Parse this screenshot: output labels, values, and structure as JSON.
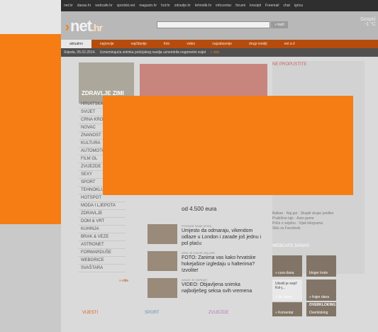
{
  "topnav": {
    "items": [
      "net.hr",
      "danas.hr",
      "webcafe.hr",
      "sportski.net",
      "magazin.hr",
      "hot.hr",
      "zdravlje.hr",
      "tehnotik.hr",
      "infocentar",
      "forumi",
      "kresipit",
      "Freemail",
      "chat",
      "igrica"
    ]
  },
  "header": {
    "logo_main": "net",
    "logo_tld": ".hr",
    "search_button": "» traži",
    "weather_city": "Gospić",
    "weather_temp": "-1 °C"
  },
  "mainnav": {
    "items": [
      "aktualno",
      "najnovije",
      "najčitanije",
      "foto",
      "video",
      "najzabavnije",
      "drugi mediji",
      "net a-ž"
    ]
  },
  "datebar": {
    "date": "Srijeda, 05.02.2014.",
    "ticker": "Uznemirujuća snimka policijskog nasilja uznemirila nogometni svijet",
    "more": "» više"
  },
  "left": {
    "promo_title": "ZDRAVLJE ZIMI",
    "categories": [
      "HRVATSKA",
      "SVIJET",
      "CRNA KRONIKA",
      "NOVAC",
      "ZNANOST",
      "KULTURA",
      "AUTOMOTO",
      "FILM GL",
      "ZVIJEZDE",
      "SEXY",
      "SPORT",
      "TEHNOKLUB",
      "HOTSPOT",
      "MODA I LJEPOTA",
      "ZDRAVLJE",
      "DOM & VRT",
      "KUHINJA",
      "BRAK & VEZE",
      "ASTRONET",
      "FORWARDUŠE",
      "WEBGRICE",
      "SVAŠTARA"
    ],
    "more": "» više"
  },
  "news": [
    {
      "kicker": "",
      "title": "od 4.500 eura"
    },
    {
      "kicker": "POHODE SANE SPISA",
      "title": "Umjesto da odmaraju, vikendom odlaze u London i zarade još jednu i pol plaću"
    },
    {
      "kicker": "DRVLJE OVDJE SHLOPE",
      "title": "FOTO: Zanima vas kako hrvatske hokejašice izgledaju u halterima? Izvolite!"
    },
    {
      "kicker": "AHAJE JE SKRIVAT",
      "title": "VIDEO: Objavljena snimka najbolješeg seksa svih vremena"
    }
  ],
  "sidebar": {
    "heading": "NE PROPUSTITE",
    "tags": [
      "Balkan · Naj goi · Skupili skupe juridike",
      "Praktične laje · Auto-gume",
      "Priče o snijehu · Vijak kilograma",
      "Sike za Facebook"
    ],
    "webcafe_heading": "WEBCAFE DANAS",
    "webcafe_tiles": [
      "» cura dana",
      "bloger krule",
      "Uloviti je sepi! Kol-j...",
      "» dic dana",
      "» frajer dana",
      "OVERKLOKING",
      "» Komentar",
      "Overkloking"
    ]
  },
  "bottom": {
    "sections": [
      "VIJESTI",
      "SPORT",
      "ZVIJEZDE"
    ]
  },
  "colors": {
    "brand_orange": "#f57d14",
    "nav_red": "#b54c0e"
  }
}
